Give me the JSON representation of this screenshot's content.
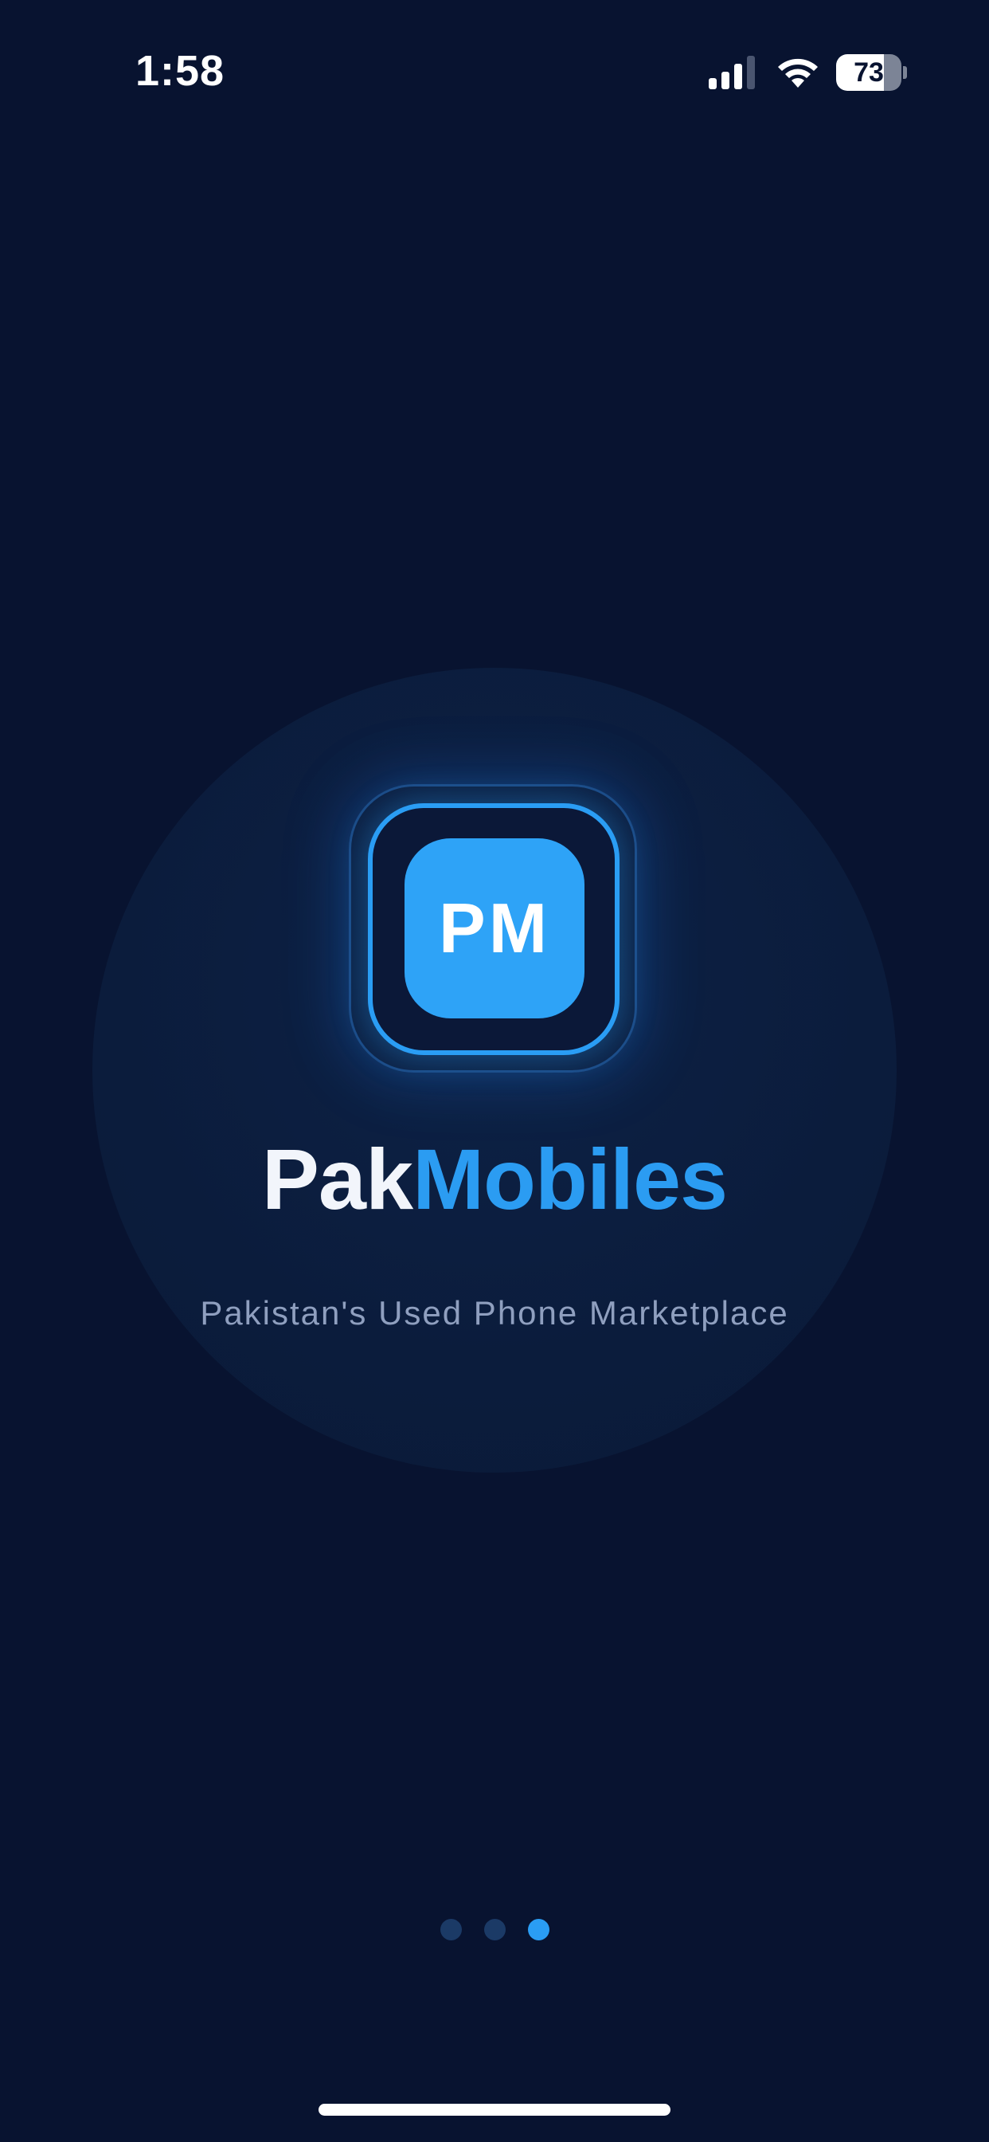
{
  "status_bar": {
    "time": "1:58",
    "battery_level": "73",
    "battery_fraction": 0.73,
    "icons": [
      "signal-icon",
      "wifi-icon",
      "battery-icon"
    ]
  },
  "splash": {
    "logo_text": "PM",
    "app_name_part1": "Pak",
    "app_name_part2": "Mobiles",
    "tagline": "Pakistan's Used Phone Marketplace"
  },
  "pagination": {
    "total": 3,
    "active_index": 2
  },
  "colors": {
    "background": "#081330",
    "accent": "#2a9df4",
    "title_primary": "#f2f5fb",
    "tagline": "#8f9fbf",
    "dot_inactive": "#1b3a66"
  }
}
